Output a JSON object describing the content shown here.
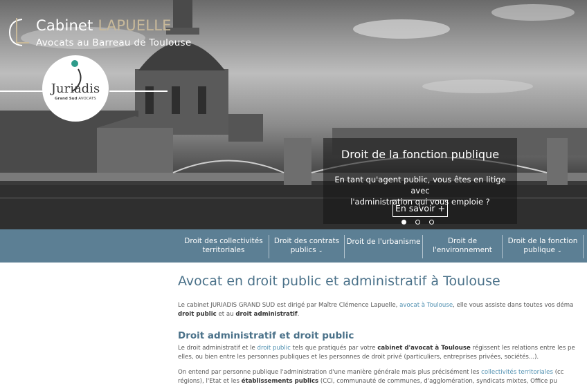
{
  "brand": {
    "title_main": "Cabinet",
    "title_accent": "LAPUELLE",
    "subtitle": "Avocats au Barreau de Toulouse"
  },
  "logo": {
    "name": "Juriadis",
    "sub_left": "Grand Sud",
    "sub_right": "AVOCATS"
  },
  "slide": {
    "title": "Droit de la fonction publique",
    "text_line1": "En tant qu'agent public, vous êtes en litige avec",
    "text_line2": "l'administration qui vous emploie ?",
    "button": "En savoir +",
    "dots": 3,
    "active_dot": 1
  },
  "nav": {
    "items": [
      {
        "line1": "Droit des collectivités",
        "line2": "territoriales",
        "caret": false
      },
      {
        "line1": "Droit des contrats",
        "line2": "publics",
        "caret": true
      },
      {
        "line1": "Droit de l'urbanisme",
        "line2": "",
        "caret": false
      },
      {
        "line1": "Droit de",
        "line2": "l'environnement",
        "caret": false
      },
      {
        "line1": "Droit de la fonction",
        "line2": "publique",
        "caret": true
      }
    ]
  },
  "content": {
    "h1": "Avocat en droit public et administratif à Toulouse",
    "intro_a": "Le cabinet JURIADIS GRAND SUD est dirigé par Maître Clémence Lapuelle,",
    "intro_link": "avocat à Toulouse",
    "intro_b": ", elle vous assiste dans toutes vos déma",
    "intro2_b1": "droit public",
    "intro2_mid": " et au ",
    "intro2_b2": "droit administratif",
    "intro2_end": ".",
    "h2": "Droit administratif et droit public",
    "p2_a": "Le droit administratif et le",
    "p2_link": "droit public",
    "p2_b": "tels que pratiqués par votre",
    "p2_bold": "cabinet d'avocat à Toulouse",
    "p2_c": "régissent les relations entre les pe",
    "p2_line2": "elles, ou bien entre les personnes publiques et les personnes de droit privé (particuliers, entreprises privées, sociétés...).",
    "p3_a": "On entend par personne publique l'administration d'une manière générale mais plus précisément les",
    "p3_link": "collectivités territoriales",
    "p3_tail": "(cc",
    "p3_l2a": "régions), l'Etat et les",
    "p3_l2bold": "établissements publics",
    "p3_l2b": "(CCI, communauté de communes, d'agglomération, syndicats mixtes, Office pu"
  },
  "colors": {
    "nav_bg": "#5c7f94",
    "heading": "#4a7189",
    "link": "#4e8fb0",
    "accent": "#c8b99a"
  }
}
